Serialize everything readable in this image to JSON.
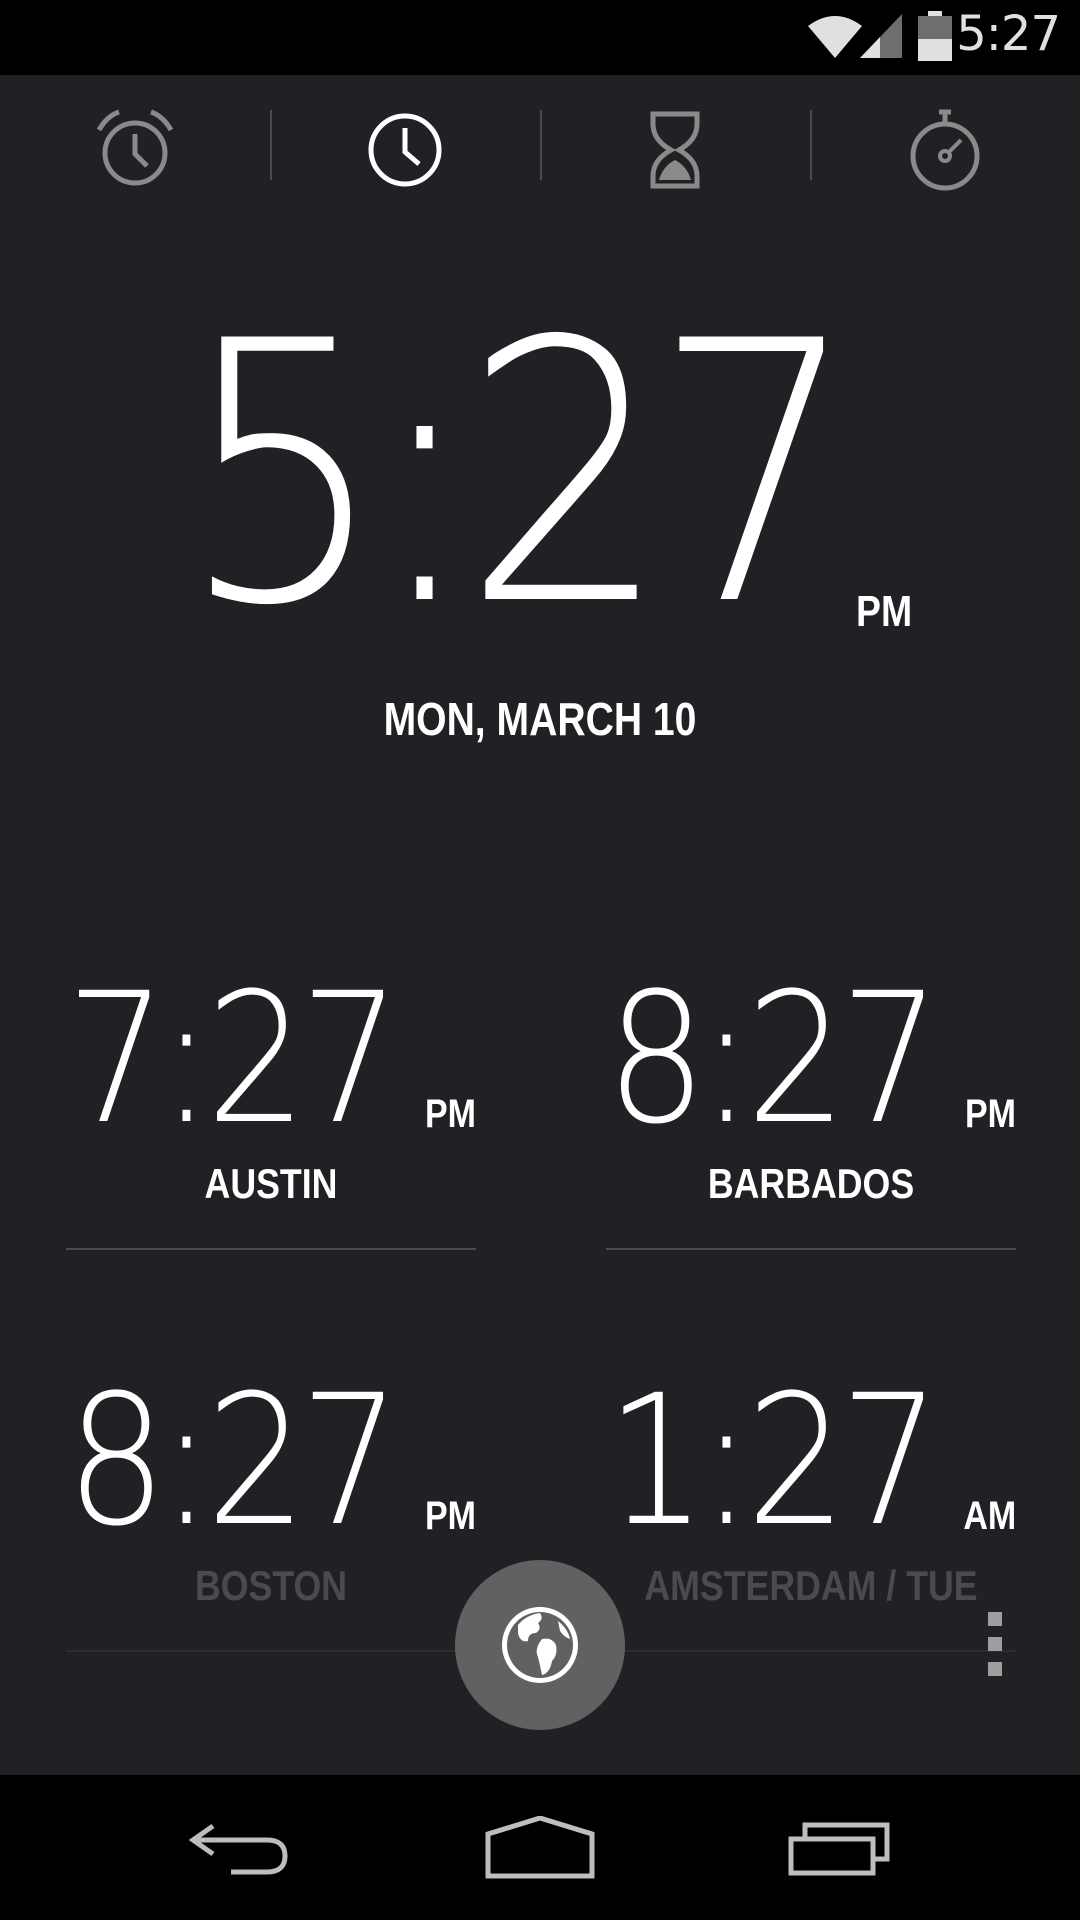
{
  "status_bar": {
    "time": "5:27",
    "icons": [
      "wifi-icon",
      "cell-signal-icon",
      "battery-icon"
    ]
  },
  "tabs": [
    {
      "name": "alarm",
      "icon": "alarm-clock-icon",
      "selected": false
    },
    {
      "name": "clock",
      "icon": "clock-icon",
      "selected": true
    },
    {
      "name": "timer",
      "icon": "hourglass-icon",
      "selected": false
    },
    {
      "name": "stopwatch",
      "icon": "stopwatch-icon",
      "selected": false
    }
  ],
  "main_clock": {
    "time": "5:27",
    "ampm": "PM",
    "date": "MON, MARCH 10"
  },
  "world_clocks": [
    {
      "time": "7:27",
      "ampm": "PM",
      "city": "AUSTIN"
    },
    {
      "time": "8:27",
      "ampm": "PM",
      "city": "BARBADOS"
    },
    {
      "time": "8:27",
      "ampm": "PM",
      "city": "BOSTON"
    },
    {
      "time": "1:27",
      "ampm": "AM",
      "city": "AMSTERDAM / TUE"
    }
  ],
  "fab": {
    "icon": "globe-icon"
  },
  "overflow": {
    "icon": "overflow-menu-icon"
  },
  "nav_bar": {
    "buttons": [
      "back-icon",
      "home-icon",
      "recent-apps-icon"
    ]
  },
  "colors": {
    "background": "#202124",
    "bar": "#000000",
    "icon_inactive": "#8a8a8a",
    "icon_active": "#ffffff",
    "fab": "#616161",
    "divider": "#4a4b4e"
  }
}
